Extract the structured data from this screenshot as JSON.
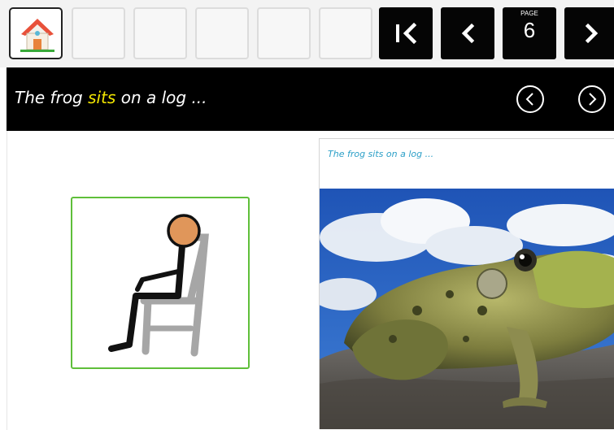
{
  "toolbar": {
    "home_icon": "house-icon",
    "empty_slots": 5,
    "first_page_icon": "first-page-icon",
    "prev_page_icon": "chevron-left-icon",
    "page_label": "PAGE",
    "page_number": "6",
    "next_page_icon": "chevron-right-icon"
  },
  "sentence_bar": {
    "before": "The frog ",
    "highlight": "sits",
    "after": " on a log ...",
    "highlight_color": "#f2e600",
    "prev_icon": "circle-chevron-left-icon",
    "next_icon": "circle-chevron-right-icon"
  },
  "symbol": {
    "icon": "sitting-person-symbol",
    "border_color": "#5fbf3a"
  },
  "photo": {
    "caption": "The frog sits on a log ...",
    "subject": "frog-photo"
  }
}
